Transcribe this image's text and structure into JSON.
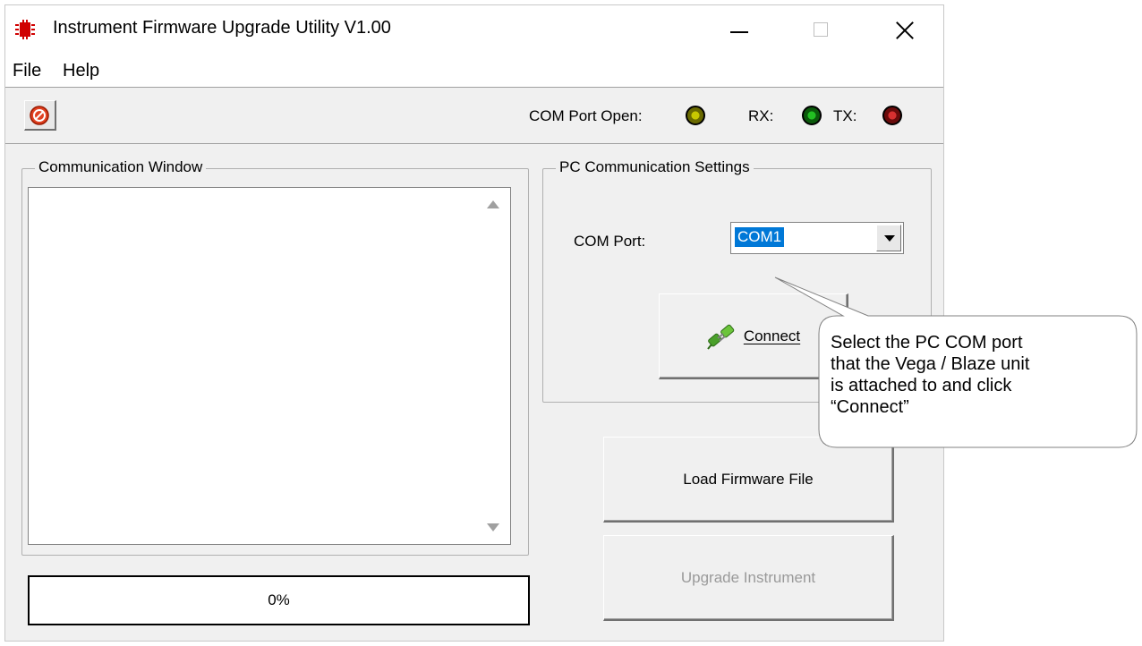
{
  "window": {
    "title": "Instrument Firmware Upgrade Utility V1.00"
  },
  "menu": {
    "file": "File",
    "help": "Help"
  },
  "status": {
    "com_port_open_label": "COM Port Open:",
    "rx_label": "RX:",
    "tx_label": "TX:",
    "com_port_led_color": "#c8c800",
    "rx_led_color": "#22c022",
    "tx_led_color": "#d83030"
  },
  "communication_window": {
    "title": "Communication Window",
    "log": ""
  },
  "progress": {
    "text": "0%",
    "value": 0
  },
  "pc_settings": {
    "title": "PC Communication Settings",
    "com_port_label": "COM Port:",
    "com_port_value": "COM1",
    "connect_label": "Connect"
  },
  "actions": {
    "load_firmware": "Load Firmware File",
    "upgrade_instrument": "Upgrade Instrument"
  },
  "callout": {
    "line1": "Select the PC COM port",
    "line2": "that the Vega / Blaze unit",
    "line3": "is attached to and click",
    "line4": "“Connect”"
  }
}
